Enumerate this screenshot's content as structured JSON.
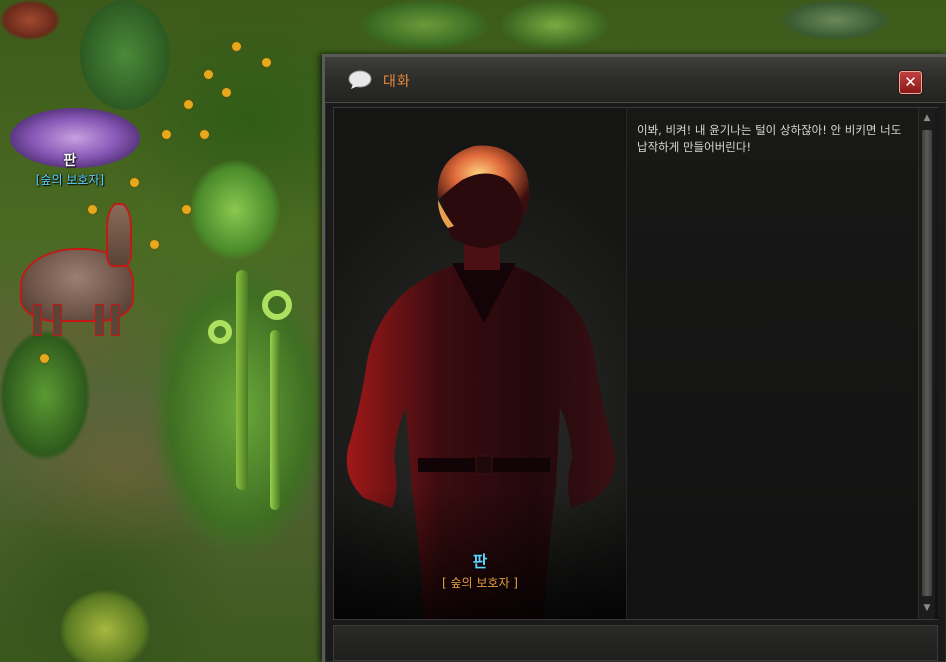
{
  "world": {
    "npc": {
      "name": "판",
      "title": "[숲의 보호자]"
    }
  },
  "dialog": {
    "title": "대화",
    "close_label": "✕",
    "speaker": {
      "name": "판",
      "title": "[ 숲의 보호자 ]"
    },
    "message": "이봐, 비켜! 내 윤기나는 털이 상하잖아! 안 비키면 너도 납작하게 만들어버린다!",
    "scroll_up": "▲",
    "scroll_down": "▼"
  },
  "colors": {
    "title_text": "#e88a3a",
    "speaker_name": "#5fd2ff",
    "speaker_title": "#e8a040",
    "close_button": "#a82828"
  }
}
